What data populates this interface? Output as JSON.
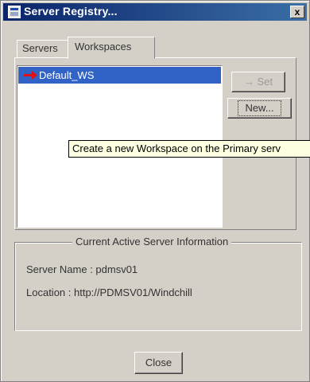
{
  "window": {
    "title": "Server Registry...",
    "close_symbol": "x"
  },
  "tabs": [
    {
      "label": "Servers",
      "active": false
    },
    {
      "label": "Workspaces",
      "active": true
    }
  ],
  "workspaces": {
    "items": [
      {
        "label": "Default_WS",
        "selected": true
      }
    ]
  },
  "buttons": {
    "set": {
      "arrow": "→",
      "label": "Set",
      "enabled": false
    },
    "new": {
      "label": "New..."
    },
    "close": {
      "label": "Close"
    }
  },
  "tooltip": {
    "text": "Create a new Workspace on the Primary serv"
  },
  "server_info": {
    "group_title": "Current Active Server Information",
    "name_text": "Server Name : pdmsv01",
    "location_text": "Location : http://PDMSV01/Windchill"
  },
  "colors": {
    "title_bar": "#0a246a",
    "selection": "#3163c6",
    "tooltip_bg": "#ffffe1",
    "dialog_bg": "#d4d0c8"
  }
}
